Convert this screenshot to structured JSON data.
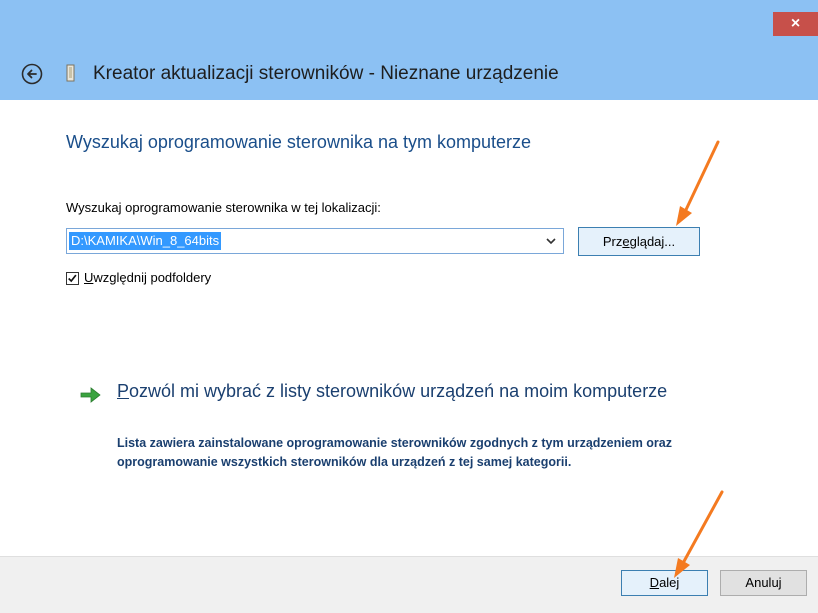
{
  "window": {
    "title": "Kreator aktualizacji sterowników - Nieznane urządzenie",
    "close_glyph": "×"
  },
  "main": {
    "heading": "Wyszukaj oprogramowanie sterownika na tym komputerze",
    "path_label": "Wyszukaj oprogramowanie sterownika w tej lokalizacji:",
    "path_value": "D:\\KAMIKA\\Win_8_64bits",
    "browse_label_pre": "Prz",
    "browse_label_u": "e",
    "browse_label_post": "glądaj...",
    "include_subfolders_u": "U",
    "include_subfolders_rest": "względnij podfoldery",
    "include_subfolders_checked": true,
    "pick_link_u": "P",
    "pick_link_rest": "ozwól mi wybrać z listy sterowników urządzeń na moim komputerze",
    "pick_desc": "Lista zawiera zainstalowane oprogramowanie sterowników zgodnych z tym urządzeniem oraz oprogramowanie wszystkich sterowników dla urządzeń z tej samej kategorii."
  },
  "footer": {
    "next_u": "D",
    "next_rest": "alej",
    "cancel_label": "Anuluj"
  },
  "icons": {
    "back": "back-arrow-icon",
    "device": "device-icon",
    "pick": "green-arrow-icon",
    "dropdown": "chevron-down-icon"
  },
  "colors": {
    "titlebar": "#8cc1f3",
    "close": "#c7504a",
    "heading": "#1a4e8a",
    "selection": "#3399ff",
    "annotation_arrow": "#f47a20"
  }
}
